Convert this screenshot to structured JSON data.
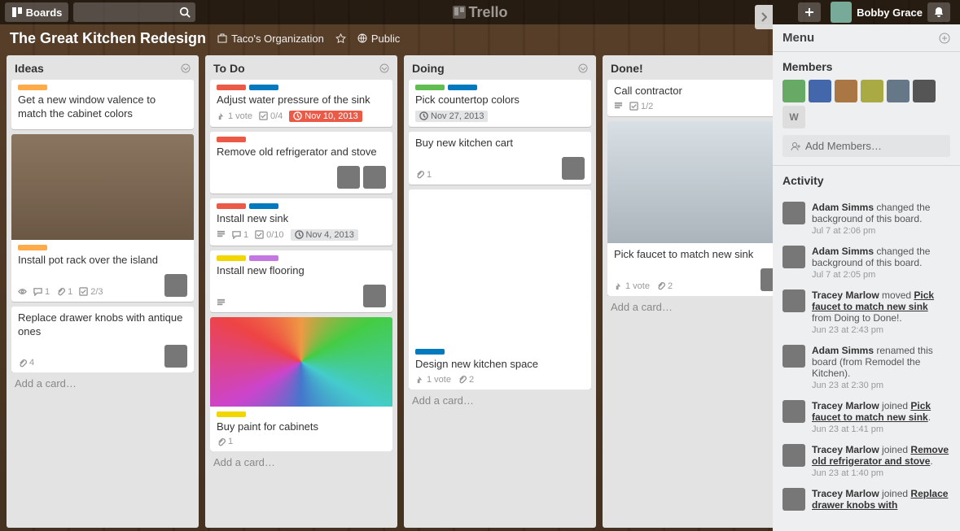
{
  "header": {
    "boards": "Boards",
    "logo": "Trello",
    "user": "Bobby Grace"
  },
  "board": {
    "title": "The Great Kitchen Redesign",
    "org": "Taco's Organization",
    "visibility": "Public"
  },
  "menu": {
    "title": "Menu",
    "members_title": "Members",
    "add_members": "Add Members…",
    "activity_title": "Activity",
    "member_initials": "W"
  },
  "lists": [
    {
      "title": "Ideas",
      "cards": [
        {
          "labels": [
            "lo"
          ],
          "title": "Get a new window valence to match the cabinet colors"
        },
        {
          "labels": [
            "lo"
          ],
          "cover": "pots",
          "title": "Install pot rack over the island",
          "badges": [
            {
              "t": "eye"
            },
            {
              "t": "comment",
              "v": "1"
            },
            {
              "t": "attach",
              "v": "1"
            },
            {
              "t": "check",
              "v": "2/3"
            }
          ],
          "members": 1
        },
        {
          "title": "Replace drawer knobs with antique ones",
          "badges": [
            {
              "t": "attach",
              "v": "4"
            }
          ],
          "members": 1
        }
      ],
      "add": "Add a card…"
    },
    {
      "title": "To Do",
      "cards": [
        {
          "labels": [
            "lr",
            "lb"
          ],
          "title": "Adjust water pressure of the sink",
          "badges": [
            {
              "t": "vote",
              "v": "1 vote"
            },
            {
              "t": "check",
              "v": "0/4"
            },
            {
              "t": "due",
              "v": "Nov 10, 2013",
              "red": true
            }
          ]
        },
        {
          "labels": [
            "lr"
          ],
          "title": "Remove old refrigerator and stove",
          "members": 2
        },
        {
          "labels": [
            "lr",
            "lb"
          ],
          "title": "Install new sink",
          "badges": [
            {
              "t": "desc"
            },
            {
              "t": "comment",
              "v": "1"
            },
            {
              "t": "check",
              "v": "0/10"
            },
            {
              "t": "due",
              "v": "Nov 4, 2013"
            }
          ]
        },
        {
          "labels": [
            "ly",
            "lp"
          ],
          "title": "Install new flooring",
          "badges": [
            {
              "t": "desc"
            }
          ],
          "members": 1
        },
        {
          "labels": [
            "ly"
          ],
          "cover": "paint",
          "title": "Buy paint for cabinets",
          "badges": [
            {
              "t": "attach",
              "v": "1"
            }
          ]
        }
      ],
      "add": "Add a card…"
    },
    {
      "title": "Doing",
      "cards": [
        {
          "labels": [
            "lg",
            "lb"
          ],
          "title": "Pick countertop colors",
          "badges": [
            {
              "t": "due",
              "v": "Nov 27, 2013"
            }
          ]
        },
        {
          "title": "Buy new kitchen cart",
          "badges": [
            {
              "t": "attach",
              "v": "1"
            }
          ],
          "members": 1
        },
        {
          "labels": [
            "lb"
          ],
          "cover": "plan",
          "title": "Design new kitchen space",
          "badges": [
            {
              "t": "vote",
              "v": "1 vote"
            },
            {
              "t": "attach",
              "v": "2"
            }
          ]
        }
      ],
      "add": "Add a card…"
    },
    {
      "title": "Done!",
      "cards": [
        {
          "title": "Call contractor",
          "badges": [
            {
              "t": "desc"
            },
            {
              "t": "check",
              "v": "1/2"
            }
          ]
        },
        {
          "cover": "faucet",
          "title": "Pick faucet to match new sink",
          "badges": [
            {
              "t": "vote",
              "v": "1 vote"
            },
            {
              "t": "attach",
              "v": "2"
            }
          ],
          "members": 1
        }
      ],
      "add": "Add a card…"
    }
  ],
  "activity": [
    {
      "who": "Adam Simms",
      "text": " changed the background of this board.",
      "time": "Jul 7 at 2:06 pm"
    },
    {
      "who": "Adam Simms",
      "text": " changed the background of this board.",
      "time": "Jul 7 at 2:05 pm"
    },
    {
      "who": "Tracey Marlow",
      "text": " moved ",
      "link": "Pick faucet to match new sink",
      "text2": " from Doing to Done!.",
      "time": "Jun 23 at 2:43 pm"
    },
    {
      "who": "Adam Simms",
      "text": " renamed this board (from Remodel the Kitchen). ",
      "time": "Jun 23 at 2:30 pm"
    },
    {
      "who": "Tracey Marlow",
      "text": " joined ",
      "link": "Pick faucet to match new sink",
      "text2": ".",
      "time": "Jun 23 at 1:41 pm"
    },
    {
      "who": "Tracey Marlow",
      "text": " joined ",
      "link": "Remove old refrigerator and stove",
      "text2": ". ",
      "time": "Jun 23 at 1:40 pm"
    },
    {
      "who": "Tracey Marlow",
      "text": " joined ",
      "link": "Replace drawer knobs with",
      "text2": ""
    }
  ]
}
